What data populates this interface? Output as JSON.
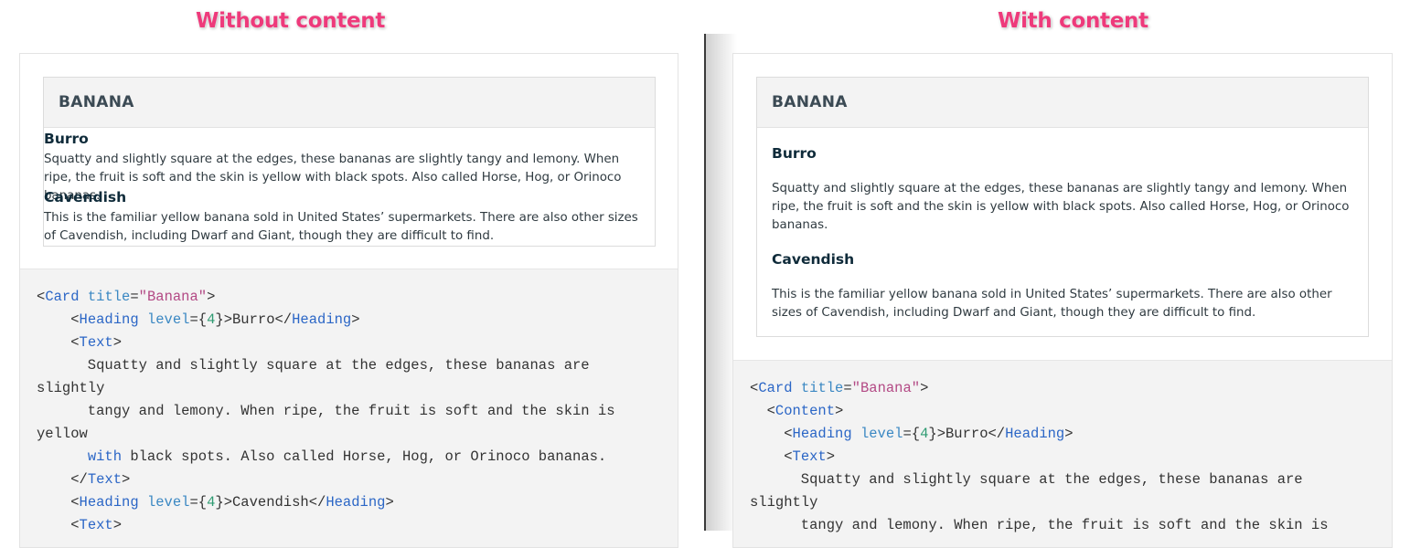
{
  "labels": {
    "left": "Without content",
    "right": "With content"
  },
  "card": {
    "title": "BANANA",
    "items": [
      {
        "heading": "Burro",
        "text": "Squatty and slightly square at the edges, these bananas are slightly tangy and lemony. When ripe, the fruit is soft and the skin is yellow with black spots. Also called Horse, Hog, or Orinoco bananas."
      },
      {
        "heading": "Cavendish",
        "text": "This is the familiar yellow banana sold in United States’ supermarkets. There are also other sizes of Cavendish, including Dwarf and Giant, though they are difficult to find."
      }
    ]
  },
  "code_left": [
    [
      [
        "p",
        "<"
      ],
      [
        "t",
        "Card"
      ],
      [
        "p",
        " "
      ],
      [
        "a",
        "title"
      ],
      [
        "p",
        "="
      ],
      [
        "s",
        "\"Banana\""
      ],
      [
        "p",
        ">"
      ]
    ],
    [
      [
        "p",
        "    <"
      ],
      [
        "t",
        "Heading"
      ],
      [
        "p",
        " "
      ],
      [
        "a",
        "level"
      ],
      [
        "p",
        "={"
      ],
      [
        "n",
        "4"
      ],
      [
        "p",
        "}>Burro</"
      ],
      [
        "t",
        "Heading"
      ],
      [
        "p",
        ">"
      ]
    ],
    [
      [
        "p",
        "    <"
      ],
      [
        "t",
        "Text"
      ],
      [
        "p",
        ">"
      ]
    ],
    [
      [
        "p",
        "      Squatty and slightly square at the edges, these bananas are"
      ]
    ],
    [
      [
        "p",
        "slightly"
      ]
    ],
    [
      [
        "p",
        "      tangy and lemony. When ripe, the fruit is soft and the skin is"
      ]
    ],
    [
      [
        "p",
        "yellow"
      ]
    ],
    [
      [
        "p",
        "      "
      ],
      [
        "t",
        "with"
      ],
      [
        "p",
        " black spots. Also called Horse, Hog, or Orinoco bananas."
      ]
    ],
    [
      [
        "p",
        "    </"
      ],
      [
        "t",
        "Text"
      ],
      [
        "p",
        ">"
      ]
    ],
    [
      [
        "p",
        "    <"
      ],
      [
        "t",
        "Heading"
      ],
      [
        "p",
        " "
      ],
      [
        "a",
        "level"
      ],
      [
        "p",
        "={"
      ],
      [
        "n",
        "4"
      ],
      [
        "p",
        "}>Cavendish</"
      ],
      [
        "t",
        "Heading"
      ],
      [
        "p",
        ">"
      ]
    ],
    [
      [
        "p",
        "    <"
      ],
      [
        "t",
        "Text"
      ],
      [
        "p",
        ">"
      ]
    ]
  ],
  "code_right": [
    [
      [
        "p",
        "<"
      ],
      [
        "t",
        "Card"
      ],
      [
        "p",
        " "
      ],
      [
        "a",
        "title"
      ],
      [
        "p",
        "="
      ],
      [
        "s",
        "\"Banana\""
      ],
      [
        "p",
        ">"
      ]
    ],
    [
      [
        "p",
        "  <"
      ],
      [
        "t",
        "Content"
      ],
      [
        "p",
        ">"
      ]
    ],
    [
      [
        "p",
        "    <"
      ],
      [
        "t",
        "Heading"
      ],
      [
        "p",
        " "
      ],
      [
        "a",
        "level"
      ],
      [
        "p",
        "={"
      ],
      [
        "n",
        "4"
      ],
      [
        "p",
        "}>Burro</"
      ],
      [
        "t",
        "Heading"
      ],
      [
        "p",
        ">"
      ]
    ],
    [
      [
        "p",
        "    <"
      ],
      [
        "t",
        "Text"
      ],
      [
        "p",
        ">"
      ]
    ],
    [
      [
        "p",
        "      Squatty and slightly square at the edges, these bananas are"
      ]
    ],
    [
      [
        "p",
        "slightly"
      ]
    ],
    [
      [
        "p",
        "      tangy and lemony. When ripe, the fruit is soft and the skin is"
      ]
    ]
  ],
  "colors": {
    "label": "#ee3a7b",
    "tag": "#2b66c6",
    "attribute": "#3b88c3",
    "string": "#b34a85",
    "number": "#2e9b72"
  }
}
